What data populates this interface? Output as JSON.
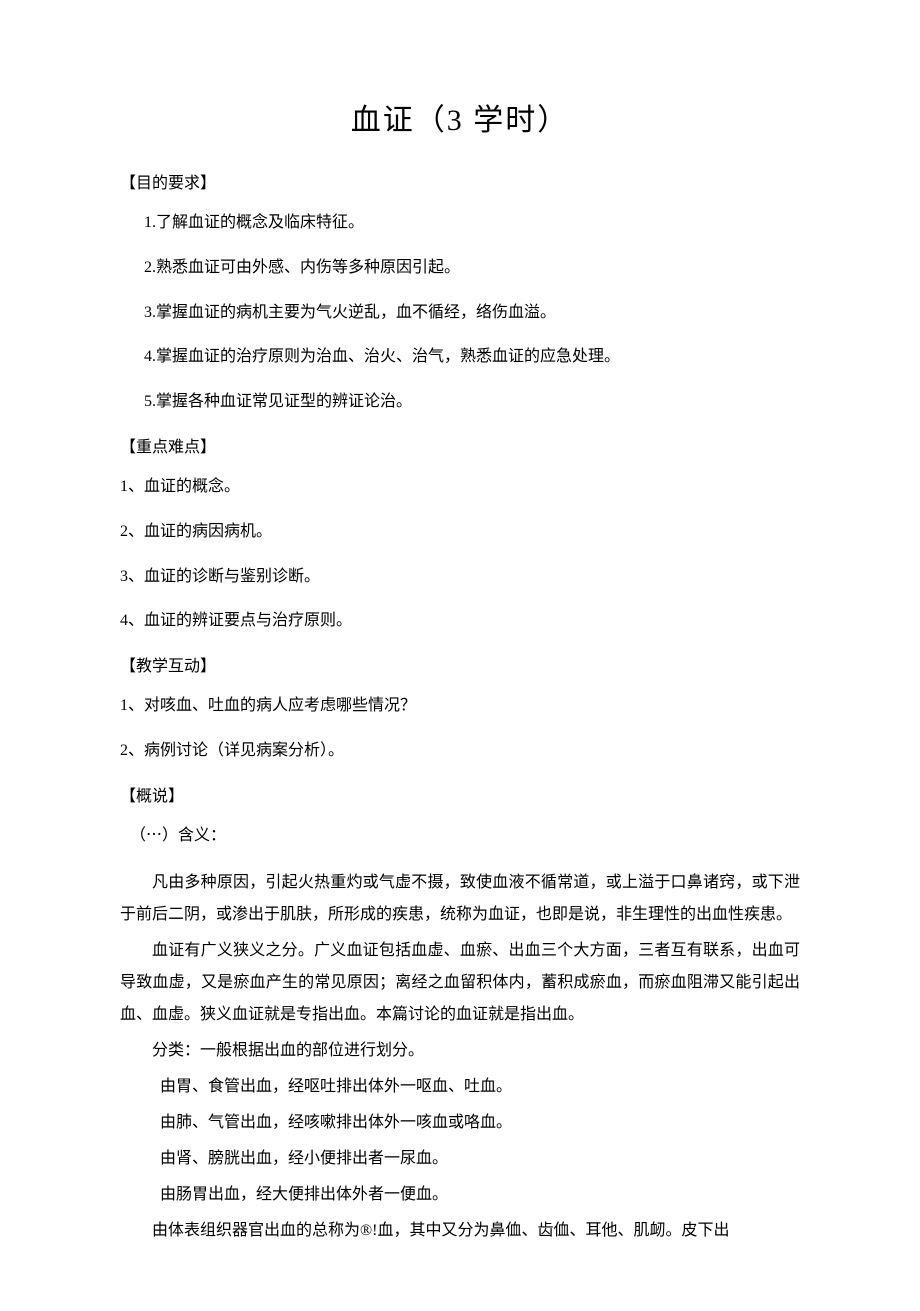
{
  "title": "血证（3 学时）",
  "sections": {
    "obj_header": "【目的要求】",
    "objectives": [
      "1.了解血证的概念及临床特征。",
      "2.熟悉血证可由外感、内伤等多种原因引起。",
      "3.掌握血证的病机主要为气火逆乱，血不循经，络伤血溢。",
      "4.掌握血证的治疗原则为治血、治火、治气，熟悉血证的应急处理。",
      "5.掌握各种血证常见证型的辨证论治。"
    ],
    "key_header": "【重点难点】",
    "keypoints": [
      "1、血证的概念。",
      "2、血证的病因病机。",
      "3、血证的诊断与鉴别诊断。",
      "4、血证的辨证要点与治疗原则。"
    ],
    "interact_header": "【教学互动】",
    "interactions": [
      "1、对咳血、吐血的病人应考虑哪些情况？",
      "2、病例讨论（详见病案分析）。"
    ],
    "overview_header": "【概说】",
    "meaning_header": "（⋯）含义：",
    "paragraphs": [
      "凡由多种原因，引起火热重灼或气虚不摄，致使血液不循常道，或上溢于口鼻诸窍，或下泄于前后二阴，或渗出于肌肤，所形成的疾患，统称为血证，也即是说，非生理性的出血性疾患。",
      "血证有广义狭义之分。广义血证包括血虚、血瘀、出血三个大方面，三者互有联系，出血可导致血虚，又是瘀血产生的常见原因；离经之血留积体内，蓄积成瘀血，而瘀血阻滞又能引起出血、血虚。狭义血证就是专指出血。本篇讨论的血证就是指出血。"
    ],
    "class_header": "分类：一般根据出血的部位进行划分。",
    "classifications": [
      "由胃、食管出血，经呕吐排出体外一呕血、吐血。",
      "由肺、气管出血，经咳嗽排出体外一咳血或咯血。",
      "由肾、膀胱出血，经小便排出者一尿血。",
      "由肠胃出血，经大便排出体外者一便血。",
      "由体表组织器官出血的总称为®!血，其中又分为鼻侐、齿侐、耳他、肌衂。皮下出"
    ]
  }
}
